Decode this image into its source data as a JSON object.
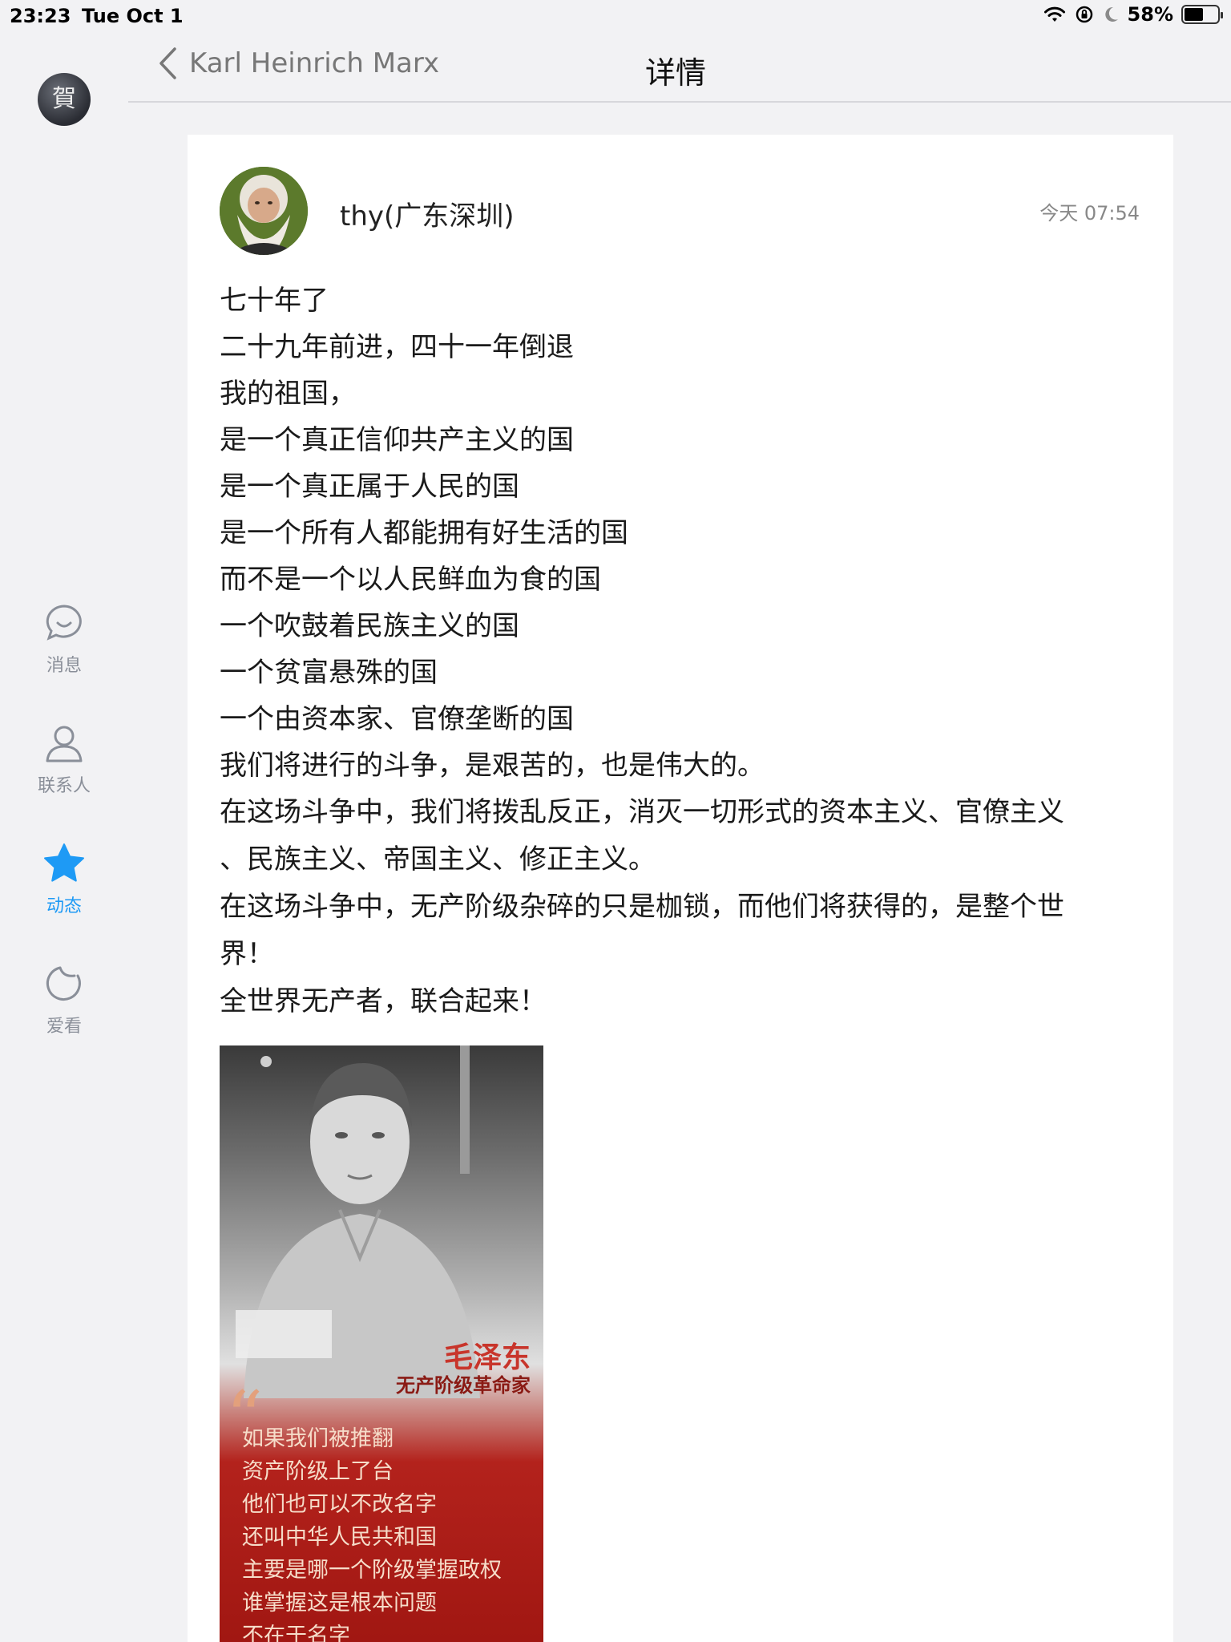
{
  "status_bar": {
    "time": "23:23",
    "date": "Tue Oct 1",
    "battery_percent": "58%",
    "battery_level": 0.58
  },
  "rail": {
    "avatar_text": "賀",
    "items": [
      {
        "label": "消息",
        "icon": "chat-bubble-icon"
      },
      {
        "label": "联系人",
        "icon": "person-icon"
      },
      {
        "label": "动态",
        "icon": "star-icon",
        "active": true
      },
      {
        "label": "爱看",
        "icon": "refresh-moon-icon"
      }
    ]
  },
  "header": {
    "back_label": "Karl Heinrich Marx",
    "title": "详情"
  },
  "post": {
    "author": "thy(广东深圳)",
    "time": "今天 07:54",
    "lines": [
      "七十年了",
      "二十九年前进，四十一年倒退",
      "我的祖国，",
      "是一个真正信仰共产主义的国",
      "是一个真正属于人民的国",
      "是一个所有人都能拥有好生活的国",
      "而不是一个以人民鲜血为食的国",
      "一个吹鼓着民族主义的国",
      "一个贫富悬殊的国",
      "一个由资本家、官僚垄断的国",
      "我们将进行的斗争，是艰苦的，也是伟大的。",
      "在这场斗争中，我们将拨乱反正，消灭一切形式的资本主义、官僚主义\n、民族主义、帝国主义、修正主义。",
      "在这场斗争中，无产阶级杂碎的只是枷锁，而他们将获得的，是整个世\n界！",
      "全世界无产者，联合起来！"
    ],
    "image": {
      "name": "毛泽东",
      "role": "无产阶级革命家",
      "quote_lines": [
        "如果我们被推翻",
        "资产阶级上了台",
        "他们也可以不改名字",
        "还叫中华人民共和国",
        "主要是哪一个阶级掌握政权",
        "谁掌握这是根本问题",
        "不在于名字"
      ]
    }
  }
}
